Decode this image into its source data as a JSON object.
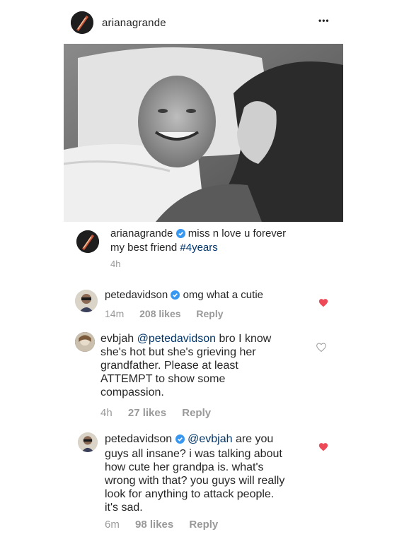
{
  "post": {
    "username": "arianagrande",
    "more_label": "•••",
    "image_alt": "photo",
    "caption": {
      "username": "arianagrande",
      "text_before": "miss n love u forever",
      "text_line2": "my best friend",
      "hashtag": "#4years",
      "time": "4h"
    }
  },
  "comments": [
    {
      "username": "petedavidson",
      "verified": true,
      "text": "omg what a cutie",
      "time": "14m",
      "likes": "208 likes",
      "reply": "Reply",
      "liked": true
    },
    {
      "username": "evbjah",
      "mention": "@petedavidson",
      "lines": [
        "bro I know",
        "she's hot but she's grieving her",
        "grandfather. Please at least",
        "ATTEMPT to show some",
        "compassion."
      ],
      "time": "4h",
      "likes": "27 likes",
      "reply": "Reply",
      "liked": false
    },
    {
      "username": "petedavidson",
      "verified": true,
      "mention": "@evbjah",
      "lines": [
        "are you",
        "guys all insane? i was talking about",
        "how cute her grandpa is. what's",
        "wrong with that? you guys will really",
        "look for anything to attack people.",
        "it's sad."
      ],
      "time": "6m",
      "likes": "98 likes",
      "reply": "Reply",
      "liked": true
    }
  ],
  "colors": {
    "verified": "#3897f0",
    "liked_heart": "#ed4956",
    "hashtag": "#003569"
  }
}
